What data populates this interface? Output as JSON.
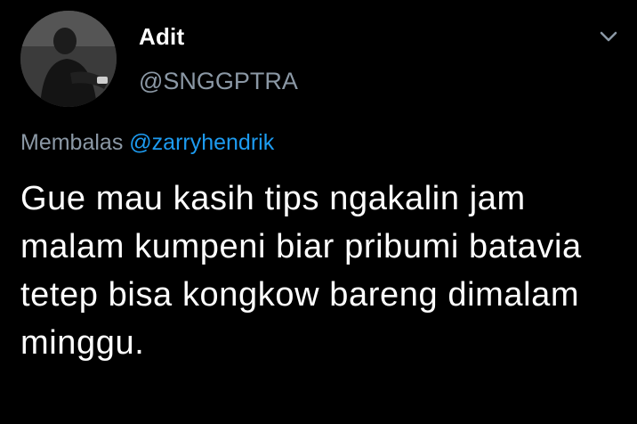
{
  "tweet": {
    "author": {
      "display_name": "Adit",
      "handle": "@SNGGPTRA"
    },
    "reply": {
      "prefix": "Membalas",
      "mention": "@zarryhendrik"
    },
    "text": "Gue mau kasih tips ngakalin jam malam kumpeni biar pribumi batavia tetep bisa kongkow bareng dimalam minggu.",
    "menu_icon": "chevron-down-icon"
  },
  "colors": {
    "background": "#000000",
    "text_primary": "#ffffff",
    "text_secondary": "#8b98a5",
    "link": "#1d9bf0"
  }
}
